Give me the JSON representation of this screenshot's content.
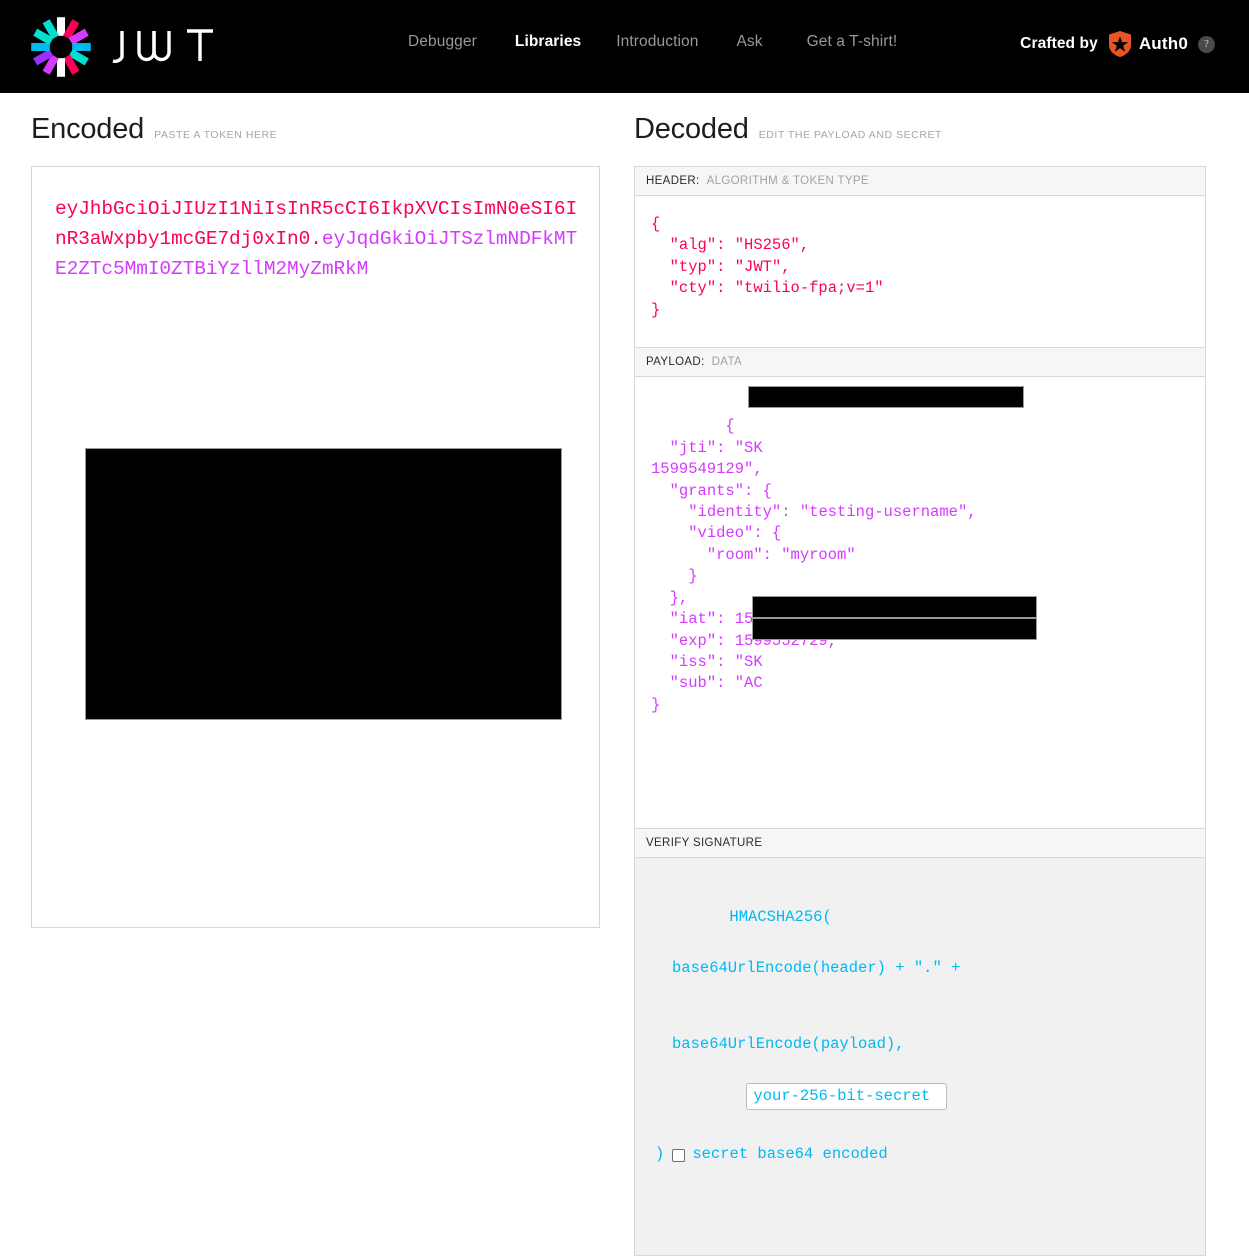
{
  "header": {
    "brand": "JWT",
    "nav": [
      {
        "label": "Debugger",
        "active": false
      },
      {
        "label": "Libraries",
        "active": true
      },
      {
        "label": "Introduction",
        "active": false
      },
      {
        "label": "Ask",
        "active": false
      },
      {
        "label": "Get a T-shirt!",
        "active": false
      }
    ],
    "crafted_by_label": "Crafted by",
    "auth0_label": "Auth0",
    "help_glyph": "?",
    "colors": {
      "bar_background": "#000000",
      "nav_inactive": "#989898",
      "nav_active": "#ffffff",
      "auth0_orange": "#eb5424"
    }
  },
  "encoded": {
    "title": "Encoded",
    "subtitle": "PASTE A TOKEN HERE",
    "token_header_part": "eyJhbGciOiJIUzI1NiIsInR5cCI6IkpXVCIsImN0eSI6InR3aWxpby1mcGE7dj0xIn0",
    "token_separator": ".",
    "token_payload_part": "eyJqdGkiOiJTSzlmNDFkMTE2ZTc5MmI0ZTBiYzllM2MyZmRkM",
    "colors": {
      "header_part": "#fb015b",
      "payload_part": "#d63aff",
      "redaction": "#000000"
    }
  },
  "decoded": {
    "title": "Decoded",
    "subtitle": "EDIT THE PAYLOAD AND SECRET",
    "header_section": {
      "label": "HEADER:",
      "label_sub": "ALGORITHM & TOKEN TYPE",
      "json": "{\n  \"alg\": \"HS256\",\n  \"typ\": \"JWT\",\n  \"cty\": \"twilio-fpa;v=1\"\n}",
      "color": "#fb015b"
    },
    "payload_section": {
      "label": "PAYLOAD:",
      "label_sub": "DATA",
      "json": "{\n  \"jti\": \"SK\n1599549129\",\n  \"grants\": {\n    \"identity\": \"testing-username\",\n    \"video\": {\n      \"room\": \"myroom\"\n    }\n  },\n  \"iat\": 1599549129,\n  \"exp\": 1599552729,\n  \"iss\": \"SK\n  \"sub\": \"AC\n}",
      "color": "#d63aff",
      "redacted_fields": [
        "jti",
        "iss",
        "sub"
      ]
    },
    "signature_section": {
      "label": "VERIFY SIGNATURE",
      "line1": "HMACSHA256(",
      "line2": "base64UrlEncode(header) + \".\" +",
      "line3": "base64UrlEncode(payload),",
      "secret_value": "your-256-bit-secret",
      "secret_placeholder": "your-256-bit-secret",
      "closing_paren": ")",
      "base64_checkbox_label": "secret base64 encoded",
      "base64_checked": false,
      "color": "#00b9f1",
      "background": "#f1f1f1"
    }
  }
}
